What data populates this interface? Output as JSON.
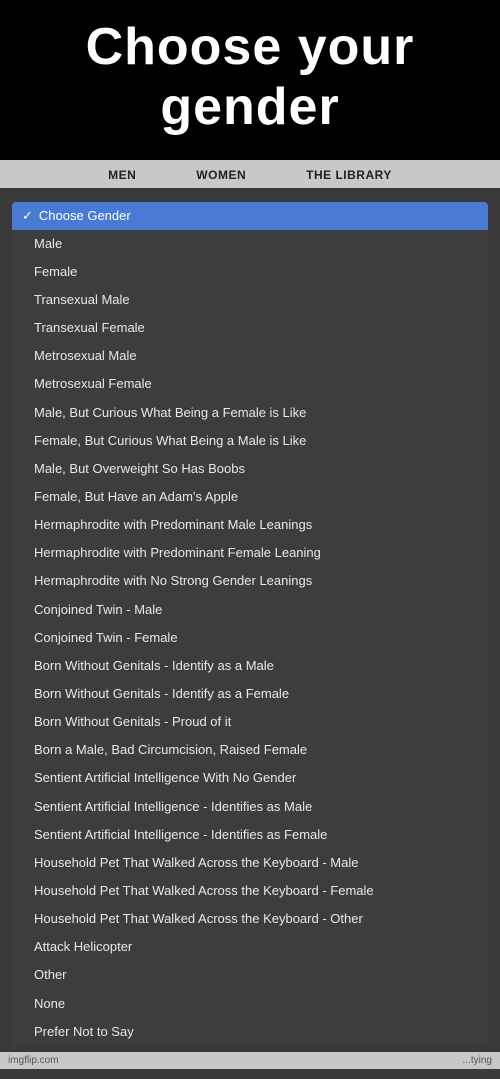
{
  "header": {
    "title": "Choose your gender"
  },
  "nav": {
    "tabs": [
      {
        "label": "MEN"
      },
      {
        "label": "WOMEN"
      },
      {
        "label": "THE LIBRARY"
      }
    ]
  },
  "dropdown": {
    "selected_label": "Choose Gender",
    "items": [
      "Male",
      "Female",
      "Transexual Male",
      "Transexual Female",
      "Metrosexual Male",
      "Metrosexual Female",
      "Male, But Curious What Being a Female is Like",
      "Female, But Curious What Being a Male is Like",
      "Male, But Overweight So Has Boobs",
      "Female, But Have an Adam's Apple",
      "Hermaphrodite with Predominant Male Leanings",
      "Hermaphrodite with Predominant Female Leaning",
      "Hermaphrodite with No Strong Gender Leanings",
      "Conjoined Twin - Male",
      "Conjoined Twin - Female",
      "Born Without Genitals - Identify as a Male",
      "Born Without Genitals - Identify as a Female",
      "Born Without Genitals - Proud of it",
      "Born a Male, Bad Circumcision, Raised Female",
      "Sentient Artificial Intelligence With No Gender",
      "Sentient Artificial Intelligence - Identifies as Male",
      "Sentient Artificial Intelligence - Identifies as Female",
      "Household Pet That Walked Across the Keyboard - Male",
      "Household Pet That Walked Across the Keyboard - Female",
      "Household Pet That Walked Across the Keyboard - Other",
      "Attack Helicopter",
      "Other",
      "None",
      "Prefer Not to Say"
    ]
  },
  "footer": {
    "logo": "imgflip.com",
    "tagline": "...tying"
  }
}
